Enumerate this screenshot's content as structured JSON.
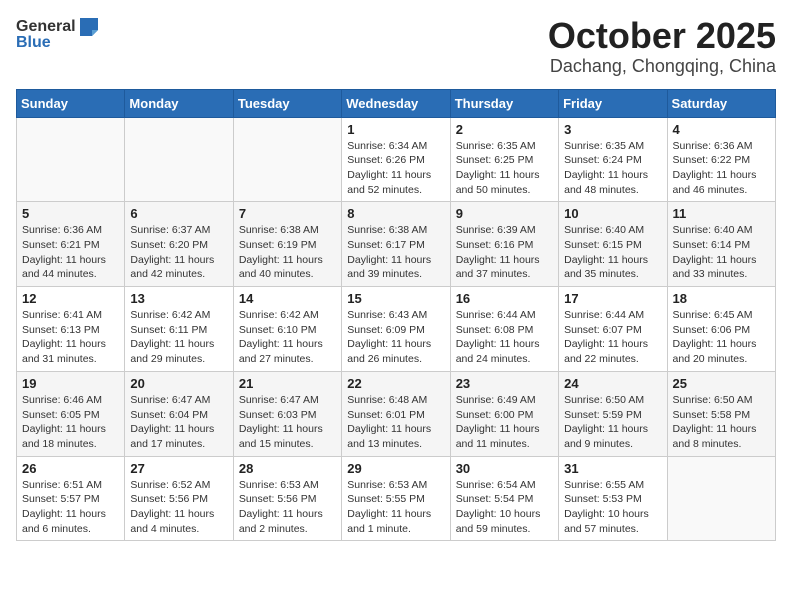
{
  "header": {
    "logo_general": "General",
    "logo_blue": "Blue",
    "month": "October 2025",
    "location": "Dachang, Chongqing, China"
  },
  "days_of_week": [
    "Sunday",
    "Monday",
    "Tuesday",
    "Wednesday",
    "Thursday",
    "Friday",
    "Saturday"
  ],
  "weeks": [
    [
      {
        "day": "",
        "info": ""
      },
      {
        "day": "",
        "info": ""
      },
      {
        "day": "",
        "info": ""
      },
      {
        "day": "1",
        "info": "Sunrise: 6:34 AM\nSunset: 6:26 PM\nDaylight: 11 hours\nand 52 minutes."
      },
      {
        "day": "2",
        "info": "Sunrise: 6:35 AM\nSunset: 6:25 PM\nDaylight: 11 hours\nand 50 minutes."
      },
      {
        "day": "3",
        "info": "Sunrise: 6:35 AM\nSunset: 6:24 PM\nDaylight: 11 hours\nand 48 minutes."
      },
      {
        "day": "4",
        "info": "Sunrise: 6:36 AM\nSunset: 6:22 PM\nDaylight: 11 hours\nand 46 minutes."
      }
    ],
    [
      {
        "day": "5",
        "info": "Sunrise: 6:36 AM\nSunset: 6:21 PM\nDaylight: 11 hours\nand 44 minutes."
      },
      {
        "day": "6",
        "info": "Sunrise: 6:37 AM\nSunset: 6:20 PM\nDaylight: 11 hours\nand 42 minutes."
      },
      {
        "day": "7",
        "info": "Sunrise: 6:38 AM\nSunset: 6:19 PM\nDaylight: 11 hours\nand 40 minutes."
      },
      {
        "day": "8",
        "info": "Sunrise: 6:38 AM\nSunset: 6:17 PM\nDaylight: 11 hours\nand 39 minutes."
      },
      {
        "day": "9",
        "info": "Sunrise: 6:39 AM\nSunset: 6:16 PM\nDaylight: 11 hours\nand 37 minutes."
      },
      {
        "day": "10",
        "info": "Sunrise: 6:40 AM\nSunset: 6:15 PM\nDaylight: 11 hours\nand 35 minutes."
      },
      {
        "day": "11",
        "info": "Sunrise: 6:40 AM\nSunset: 6:14 PM\nDaylight: 11 hours\nand 33 minutes."
      }
    ],
    [
      {
        "day": "12",
        "info": "Sunrise: 6:41 AM\nSunset: 6:13 PM\nDaylight: 11 hours\nand 31 minutes."
      },
      {
        "day": "13",
        "info": "Sunrise: 6:42 AM\nSunset: 6:11 PM\nDaylight: 11 hours\nand 29 minutes."
      },
      {
        "day": "14",
        "info": "Sunrise: 6:42 AM\nSunset: 6:10 PM\nDaylight: 11 hours\nand 27 minutes."
      },
      {
        "day": "15",
        "info": "Sunrise: 6:43 AM\nSunset: 6:09 PM\nDaylight: 11 hours\nand 26 minutes."
      },
      {
        "day": "16",
        "info": "Sunrise: 6:44 AM\nSunset: 6:08 PM\nDaylight: 11 hours\nand 24 minutes."
      },
      {
        "day": "17",
        "info": "Sunrise: 6:44 AM\nSunset: 6:07 PM\nDaylight: 11 hours\nand 22 minutes."
      },
      {
        "day": "18",
        "info": "Sunrise: 6:45 AM\nSunset: 6:06 PM\nDaylight: 11 hours\nand 20 minutes."
      }
    ],
    [
      {
        "day": "19",
        "info": "Sunrise: 6:46 AM\nSunset: 6:05 PM\nDaylight: 11 hours\nand 18 minutes."
      },
      {
        "day": "20",
        "info": "Sunrise: 6:47 AM\nSunset: 6:04 PM\nDaylight: 11 hours\nand 17 minutes."
      },
      {
        "day": "21",
        "info": "Sunrise: 6:47 AM\nSunset: 6:03 PM\nDaylight: 11 hours\nand 15 minutes."
      },
      {
        "day": "22",
        "info": "Sunrise: 6:48 AM\nSunset: 6:01 PM\nDaylight: 11 hours\nand 13 minutes."
      },
      {
        "day": "23",
        "info": "Sunrise: 6:49 AM\nSunset: 6:00 PM\nDaylight: 11 hours\nand 11 minutes."
      },
      {
        "day": "24",
        "info": "Sunrise: 6:50 AM\nSunset: 5:59 PM\nDaylight: 11 hours\nand 9 minutes."
      },
      {
        "day": "25",
        "info": "Sunrise: 6:50 AM\nSunset: 5:58 PM\nDaylight: 11 hours\nand 8 minutes."
      }
    ],
    [
      {
        "day": "26",
        "info": "Sunrise: 6:51 AM\nSunset: 5:57 PM\nDaylight: 11 hours\nand 6 minutes."
      },
      {
        "day": "27",
        "info": "Sunrise: 6:52 AM\nSunset: 5:56 PM\nDaylight: 11 hours\nand 4 minutes."
      },
      {
        "day": "28",
        "info": "Sunrise: 6:53 AM\nSunset: 5:56 PM\nDaylight: 11 hours\nand 2 minutes."
      },
      {
        "day": "29",
        "info": "Sunrise: 6:53 AM\nSunset: 5:55 PM\nDaylight: 11 hours\nand 1 minute."
      },
      {
        "day": "30",
        "info": "Sunrise: 6:54 AM\nSunset: 5:54 PM\nDaylight: 10 hours\nand 59 minutes."
      },
      {
        "day": "31",
        "info": "Sunrise: 6:55 AM\nSunset: 5:53 PM\nDaylight: 10 hours\nand 57 minutes."
      },
      {
        "day": "",
        "info": ""
      }
    ]
  ]
}
